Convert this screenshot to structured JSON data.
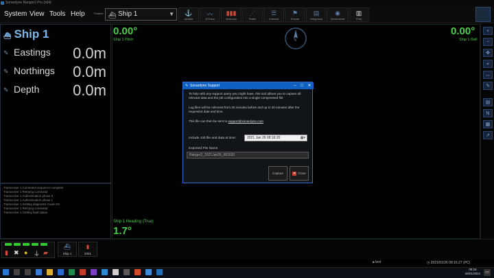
{
  "titlebar": {
    "text": "Sonardyne Ranger2 Pro (x64)"
  },
  "menu": {
    "system": "System",
    "view": "View",
    "tools": "Tools",
    "help": "Help"
  },
  "feature": {
    "label": "Feature",
    "selected": "Ship 1",
    "icon": "ship-icon"
  },
  "toolbar": [
    {
      "label": "Update"
    },
    {
      "label": "GiTrace"
    },
    {
      "label": "Beacons"
    },
    {
      "label": "Paths"
    },
    {
      "label": "Camera"
    },
    {
      "label": "Events"
    },
    {
      "label": "Telegrams"
    },
    {
      "label": "Screenshot"
    },
    {
      "label": "Print"
    }
  ],
  "left": {
    "ship": "Ship 1",
    "metrics": [
      {
        "label": "Eastings",
        "value": "0.0m"
      },
      {
        "label": "Northings",
        "value": "0.0m"
      },
      {
        "label": "Depth",
        "value": "0.0m"
      }
    ]
  },
  "log": [
    "Transceiver 1 Command sequence complete",
    "Transceiver 1 Retrying command",
    "Transceiver 1 Authentication phase 2",
    "Transceiver 1 Authentication phase 1",
    "Transceiver 1 Getting diagnostic mode On",
    "Transceiver 1 Retrying command",
    "Transceiver 1 Getting fault status"
  ],
  "attitude": {
    "pitch_value": "0.00°",
    "pitch_label": "Ship 1 Pitch",
    "roll_value": "0.00°",
    "roll_label": "Ship 1 Roll",
    "heading_label": "Ship 1 Heading (True)",
    "heading_value": "1.7°"
  },
  "dialog": {
    "title": "Sonardyne Support",
    "para1": "To help with any support query you might have, this tool allows you to capture all relevant data and the job configuration into a single compressed file",
    "para2": "Log files will be collected from 30 minutes before and up to 30 minutes after the requested date and time.",
    "para3_prefix": "This file can then be sent to ",
    "email": "support@sonardyne.com",
    "include_label": "Include Job file and data at time:",
    "datetime": "2021 Jan 26  08:16:20",
    "exported_label": "Exported File Name",
    "exported_value": "Ranger2_2021Jan26_081620",
    "capture": "Capture",
    "close": "Close"
  },
  "devices": [
    {
      "label": "Ship 1"
    },
    {
      "label": "2031"
    }
  ],
  "status": {
    "user": "test",
    "datetime": "2021/01/26 08:16:27 (PC)"
  },
  "taskbar": {
    "time": "08:16",
    "date": "26/01/2021"
  },
  "colors": {
    "accent": "#0f62c4",
    "ship_blue": "#7db7ea",
    "attitude_green": "#4ad14a"
  }
}
